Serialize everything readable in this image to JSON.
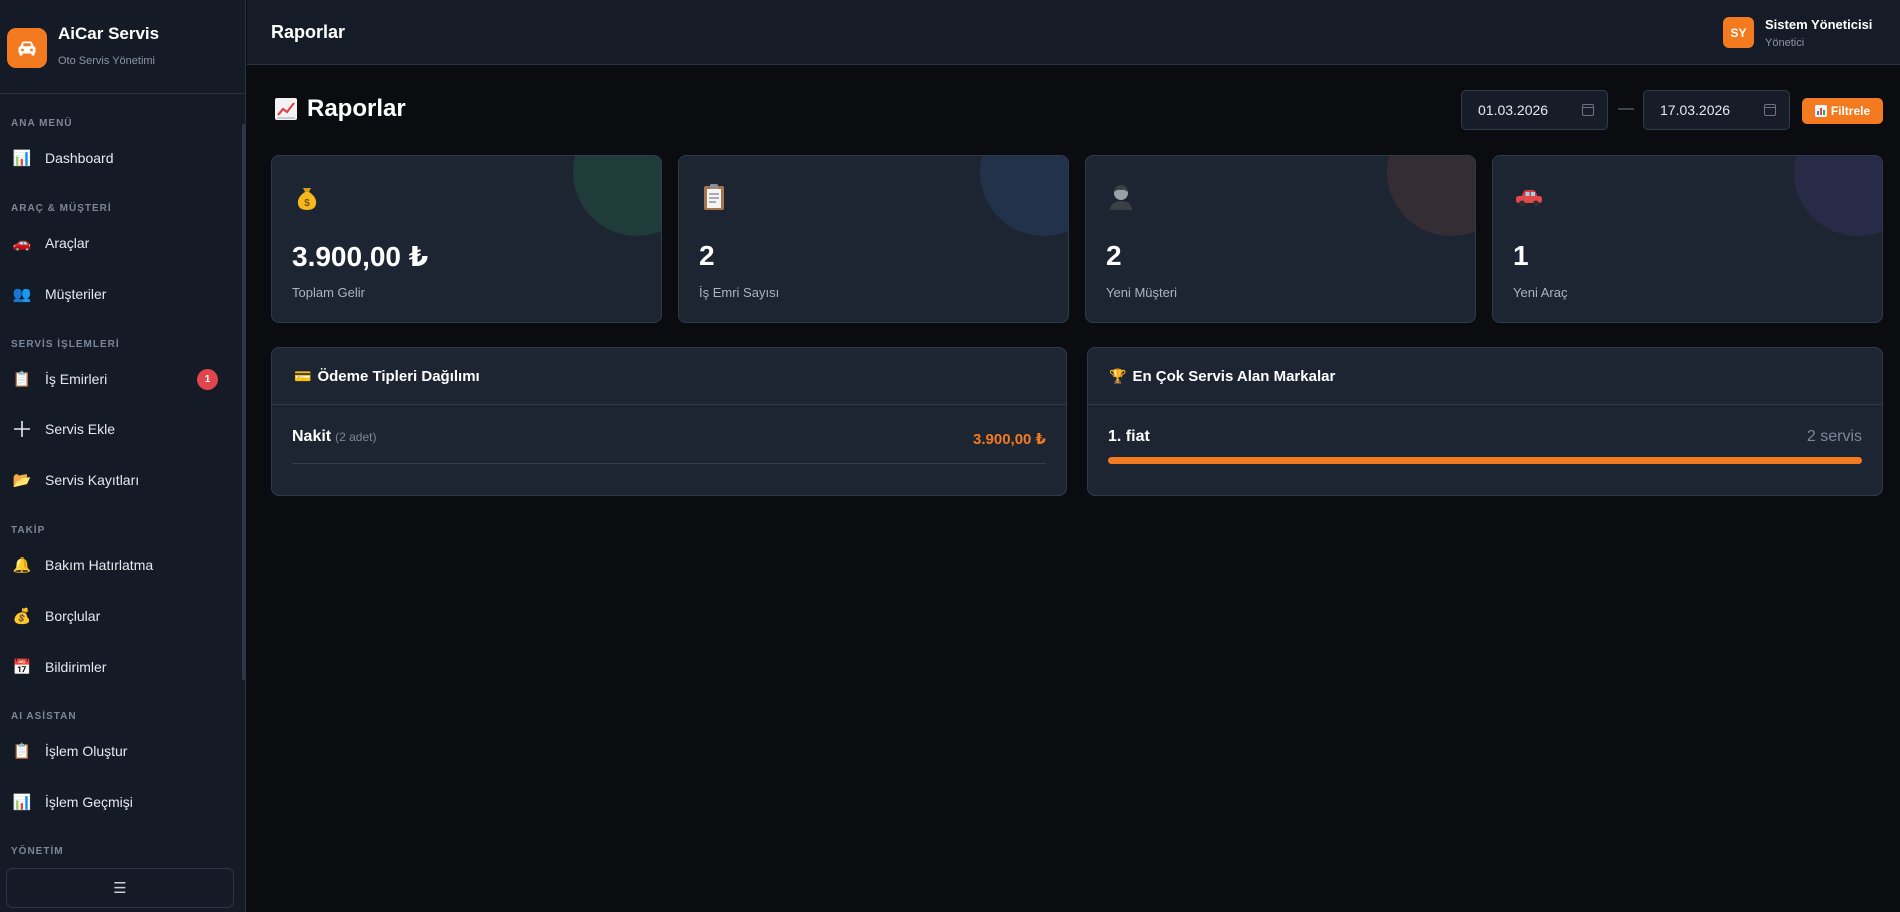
{
  "sidebar": {
    "brand_name": "AiCar Servis",
    "brand_subtitle": "Oto Servis Yönetimi",
    "sections": [
      {
        "title": "ANA MENÜ"
      },
      {
        "title": "ARAÇ & MÜŞTERİ"
      },
      {
        "title": "SERVİS İŞLEMLERİ"
      },
      {
        "title": "TAKİP"
      },
      {
        "title": "AI ASİSTAN"
      },
      {
        "title": "YÖNETİM"
      }
    ],
    "items": [
      {
        "label": "Dashboard",
        "icon": "📊"
      },
      {
        "label": "Araçlar",
        "icon": "🚗"
      },
      {
        "label": "Müşteriler",
        "icon": "👥"
      },
      {
        "label": "İş Emirleri",
        "icon": "📋",
        "badge": "1"
      },
      {
        "label": "Servis Ekle",
        "icon": "＋"
      },
      {
        "label": "Servis Kayıtları",
        "icon": "📂"
      },
      {
        "label": "Bakım Hatırlatma",
        "icon": "🔔"
      },
      {
        "label": "Borçlular",
        "icon": "💰"
      },
      {
        "label": "Bildirimler",
        "icon": "📅"
      },
      {
        "label": "İşlem Oluştur",
        "icon": "📋"
      },
      {
        "label": "İşlem Geçmişi",
        "icon": "📊"
      }
    ],
    "collapse_label": "☰"
  },
  "header": {
    "title": "Raporlar",
    "user_initials": "SY",
    "user_name": "Sistem Yöneticisi",
    "user_role": "Yönetici"
  },
  "page": {
    "title": "Raporlar",
    "date_from": "01.03.2026",
    "date_separator": "—",
    "date_to": "17.03.2026",
    "filter_label": "Filtrele"
  },
  "stats": [
    {
      "icon": "💰",
      "value": "3.900,00 ₺",
      "label": "Toplam Gelir",
      "accent": "#1f3b3a"
    },
    {
      "icon": "📋",
      "value": "2",
      "label": "İş Emri Sayısı",
      "accent": "#22324a"
    },
    {
      "icon": "🧑",
      "value": "2",
      "label": "Yeni Müşteri",
      "accent": "#352d34"
    },
    {
      "icon": "🚗",
      "value": "1",
      "label": "Yeni Araç",
      "accent": "#272b47"
    }
  ],
  "payment_panel": {
    "icon": "💳",
    "title": "Ödeme Tipleri Dağılımı",
    "rows": [
      {
        "name": "Nakit",
        "count": "(2 adet)",
        "amount": "3.900,00 ₺"
      }
    ]
  },
  "brands_panel": {
    "icon": "🏆",
    "title": "En Çok Servis Alan Markalar",
    "rows": [
      {
        "name": "1. fiat",
        "count": "2 servis",
        "share": 1.0
      }
    ]
  },
  "colors": {
    "accent": "#f47a20",
    "badge": "#e0454b",
    "background": "#0b0c10",
    "panel": "#1d2533"
  }
}
